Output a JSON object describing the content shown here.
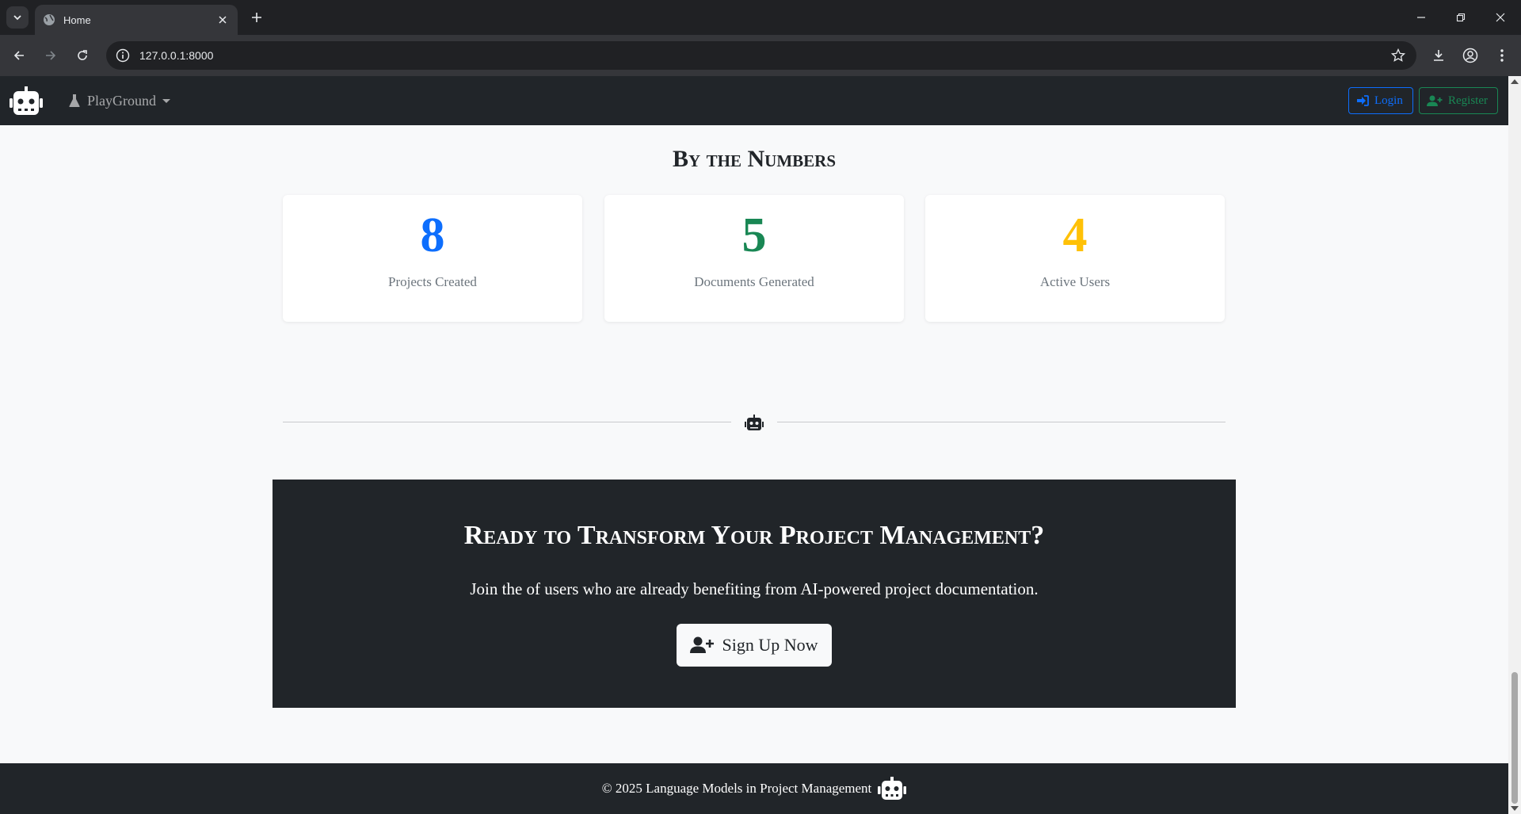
{
  "browser": {
    "tab_title": "Home",
    "url": "127.0.0.1:8000"
  },
  "navbar": {
    "brand_icon": "robot-icon",
    "playground_label": "PlayGround",
    "login_label": "Login",
    "register_label": "Register"
  },
  "stats": {
    "title": "By the Numbers",
    "items": [
      {
        "value": "8",
        "label": "Projects Created",
        "color": "#0d6efd"
      },
      {
        "value": "5",
        "label": "Documents Generated",
        "color": "#198754"
      },
      {
        "value": "4",
        "label": "Active Users",
        "color": "#ffc107"
      }
    ]
  },
  "cta": {
    "title": "Ready to Transform Your Project Management?",
    "text": "Join the of users who are already benefiting from AI-powered project documentation.",
    "button_label": "Sign Up Now"
  },
  "footer": {
    "text": "© 2025 Language Models in Project Management"
  }
}
